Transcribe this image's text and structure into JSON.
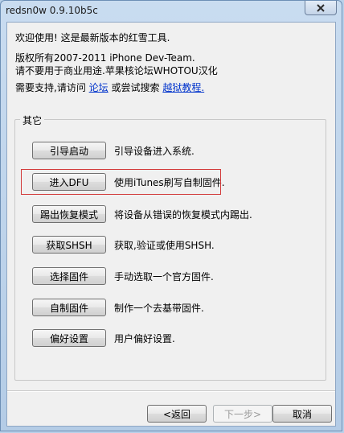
{
  "window": {
    "title": "redsn0w 0.9.10b5c"
  },
  "intro": {
    "welcome": "欢迎使用! 这是最新版本的红雪工具.",
    "copyright": "版权所有2007-2011 iPhone Dev-Team.",
    "license": "请不要用于商业用途.苹果核论坛WHOTOU汉化",
    "help_prefix": "需要支持,请访问",
    "forum_link": "论坛",
    "help_middle": "或尝试搜索",
    "tutorial_link": "越狱教程."
  },
  "group": {
    "label": "其它",
    "items": [
      {
        "button": "引导启动",
        "desc": "引导设备进入系统."
      },
      {
        "button": "进入DFU",
        "desc": "使用iTunes刷写自制固件."
      },
      {
        "button": "踢出恢复模式",
        "desc": "将设备从错误的恢复模式内踢出."
      },
      {
        "button": "获取SHSH",
        "desc": "获取,验证或使用SHSH."
      },
      {
        "button": "选择固件",
        "desc": "手动选取一个官方固件."
      },
      {
        "button": "自制固件",
        "desc": "制作一个去基带固件."
      },
      {
        "button": "偏好设置",
        "desc": "用户偏好设置."
      }
    ]
  },
  "footer": {
    "back": "<返回",
    "next": "下一步>",
    "cancel": "取消"
  },
  "colors": {
    "highlight": "#d23a3a",
    "link": "#0033cc"
  },
  "icons": {
    "close": "close-icon"
  }
}
